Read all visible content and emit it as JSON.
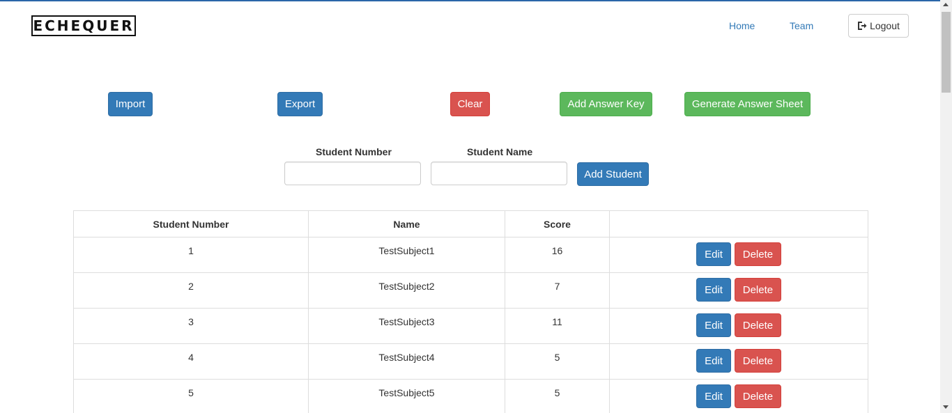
{
  "header": {
    "logo": "ECHEQUER",
    "nav": {
      "home": "Home",
      "team": "Team"
    },
    "logout_label": "Logout"
  },
  "toolbar": {
    "import_label": "Import",
    "export_label": "Export",
    "clear_label": "Clear",
    "add_answer_key_label": "Add Answer Key",
    "generate_answer_sheet_label": "Generate Answer Sheet"
  },
  "form": {
    "student_number_label": "Student Number",
    "student_name_label": "Student Name",
    "student_number_value": "",
    "student_name_value": "",
    "add_student_label": "Add Student"
  },
  "table": {
    "headers": [
      "Student Number",
      "Name",
      "Score",
      ""
    ],
    "rows": [
      {
        "number": "1",
        "name": "TestSubject1",
        "score": "16"
      },
      {
        "number": "2",
        "name": "TestSubject2",
        "score": "7"
      },
      {
        "number": "3",
        "name": "TestSubject3",
        "score": "11"
      },
      {
        "number": "4",
        "name": "TestSubject4",
        "score": "5"
      },
      {
        "number": "5",
        "name": "TestSubject5",
        "score": "5"
      }
    ],
    "edit_label": "Edit",
    "delete_label": "Delete"
  },
  "colors": {
    "primary": "#337ab7",
    "danger": "#d9534f",
    "success": "#5cb85c",
    "link": "#337ab7"
  }
}
